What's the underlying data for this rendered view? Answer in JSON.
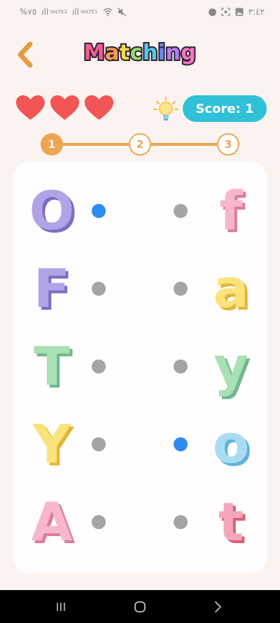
{
  "status_bar": {
    "battery": "%٧٥",
    "volte_1": "VoLTE2",
    "volte_2": "VoLTE1",
    "time": "٣:٤٢"
  },
  "header": {
    "back_icon": "chevron-left-icon",
    "title_letters": [
      "M",
      "a",
      "t",
      "c",
      "h",
      "i",
      "n",
      "g"
    ],
    "title_colors": [
      "#f75c8f",
      "#ff9a4c",
      "#ffd74a",
      "#8fde6b",
      "#55c9ee",
      "#6d8cf2",
      "#b77cf0",
      "#f574c4"
    ]
  },
  "lives": {
    "count": 3,
    "color": "#f25555"
  },
  "hint": {
    "icon": "lightbulb-icon"
  },
  "score": {
    "label": "Score: 1"
  },
  "progress": {
    "steps": [
      "1",
      "2",
      "3"
    ],
    "current": 1,
    "color": "#eda553"
  },
  "pairs": {
    "left": [
      {
        "letter": "O",
        "color": "#b3a2e6",
        "shade": "#7e6cc4"
      },
      {
        "letter": "F",
        "color": "#b3a2e6",
        "shade": "#7e6cc4"
      },
      {
        "letter": "T",
        "color": "#a9e0b6",
        "shade": "#6fb88c"
      },
      {
        "letter": "Y",
        "color": "#fbe27a",
        "shade": "#e0b735"
      },
      {
        "letter": "A",
        "color": "#f7b7cb",
        "shade": "#e07b9c"
      }
    ],
    "right": [
      {
        "letter": "f",
        "color": "#f7b7cb",
        "shade": "#e07b9c"
      },
      {
        "letter": "a",
        "color": "#fbe27a",
        "shade": "#e0b735"
      },
      {
        "letter": "y",
        "color": "#a9e0b6",
        "shade": "#6fb88c"
      },
      {
        "letter": "o",
        "color": "#a9dcf3",
        "shade": "#5fb3dd"
      },
      {
        "letter": "t",
        "color": "#f5a7b9",
        "shade": "#d8607e"
      }
    ],
    "selected_left": 0,
    "selected_right": 3,
    "dot_color": "#a4a4a4",
    "selected_dot_color": "#2e8bef"
  },
  "nav": {
    "recents_icon": "recents-icon",
    "home_icon": "home-icon",
    "back_icon": "nav-back-icon"
  }
}
